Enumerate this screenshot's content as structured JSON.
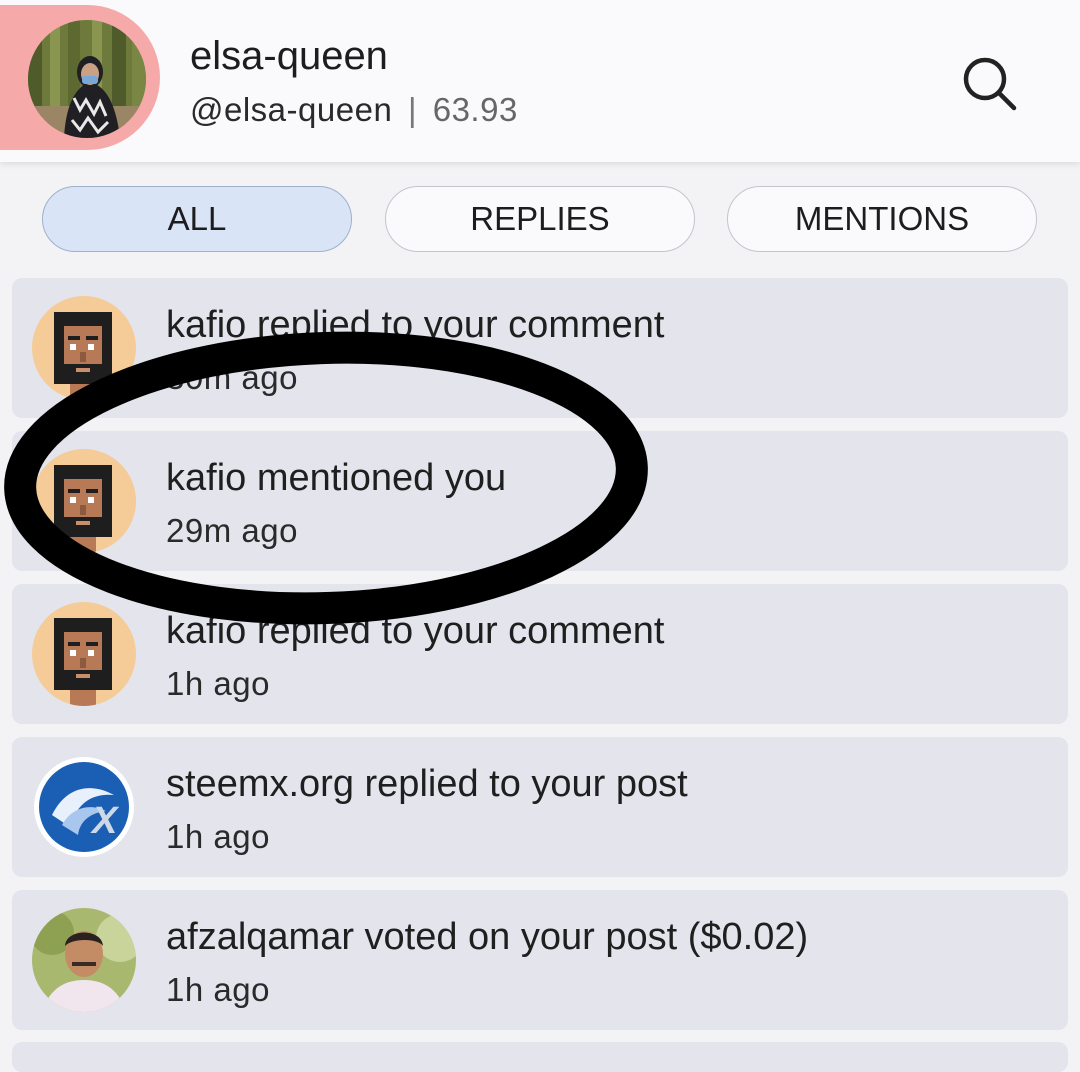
{
  "header": {
    "username": "elsa-queen",
    "handle": "@elsa-queen",
    "separator": "|",
    "reputation": "63.93",
    "icons": {
      "search": "search-icon"
    }
  },
  "tabs": [
    {
      "label": "ALL",
      "active": true
    },
    {
      "label": "REPLIES",
      "active": false
    },
    {
      "label": "MENTIONS",
      "active": false
    }
  ],
  "notifications": [
    {
      "message": "kafio replied to your comment",
      "time": "30m ago",
      "avatar": "pixel-man-avatar"
    },
    {
      "message": "kafio mentioned you",
      "time": "29m ago",
      "avatar": "pixel-man-avatar"
    },
    {
      "message": "kafio replied to your comment",
      "time": "1h ago",
      "avatar": "pixel-man-avatar"
    },
    {
      "message": "steemx.org replied to your post",
      "time": "1h ago",
      "avatar": "steemx-logo-avatar"
    },
    {
      "message": "afzalqamar voted on your post ($0.02)",
      "time": "1h ago",
      "avatar": "person-photo-avatar"
    }
  ],
  "colors": {
    "active_tab": "#d9e4f7",
    "card_bg": "#e3e4ec",
    "profile_highlight": "#f6a9a9",
    "annotation_ink": "#000000"
  }
}
